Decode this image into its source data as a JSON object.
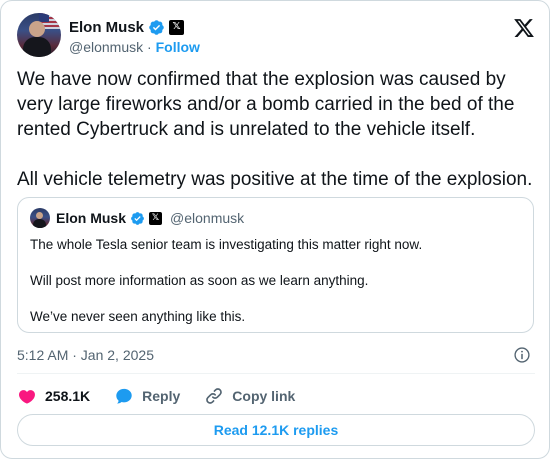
{
  "author": {
    "display_name": "Elon Musk",
    "handle": "@elonmusk",
    "separator": " · ",
    "follow_label": "Follow"
  },
  "tweet": {
    "paragraphs": [
      "We have now confirmed that the explosion was caused by very large fireworks and/or a bomb carried in the bed of the rented Cybertruck and is unrelated to the vehicle itself.",
      "All vehicle telemetry was positive at the time of the explosion."
    ]
  },
  "quoted_tweet": {
    "display_name": "Elon Musk",
    "handle": "@elonmusk",
    "paragraphs": [
      "The whole Tesla senior team is investigating this matter right now.",
      "Will post more information as soon as we learn anything.",
      "We’ve never seen anything like this."
    ]
  },
  "timestamp": "5:12 AM · Jan 2, 2025",
  "actions": {
    "likes": "258.1K",
    "reply_label": "Reply",
    "copy_link_label": "Copy link"
  },
  "read_replies_label": "Read 12.1K replies",
  "colors": {
    "accent": "#1d9bf0",
    "like": "#f91880",
    "text": "#0f1419",
    "muted": "#536471",
    "border": "#cfd9de"
  },
  "icons": [
    "verified-badge-icon",
    "x-affiliate-icon",
    "x-logo-icon",
    "info-icon",
    "heart-icon",
    "reply-bubble-icon",
    "link-icon"
  ]
}
